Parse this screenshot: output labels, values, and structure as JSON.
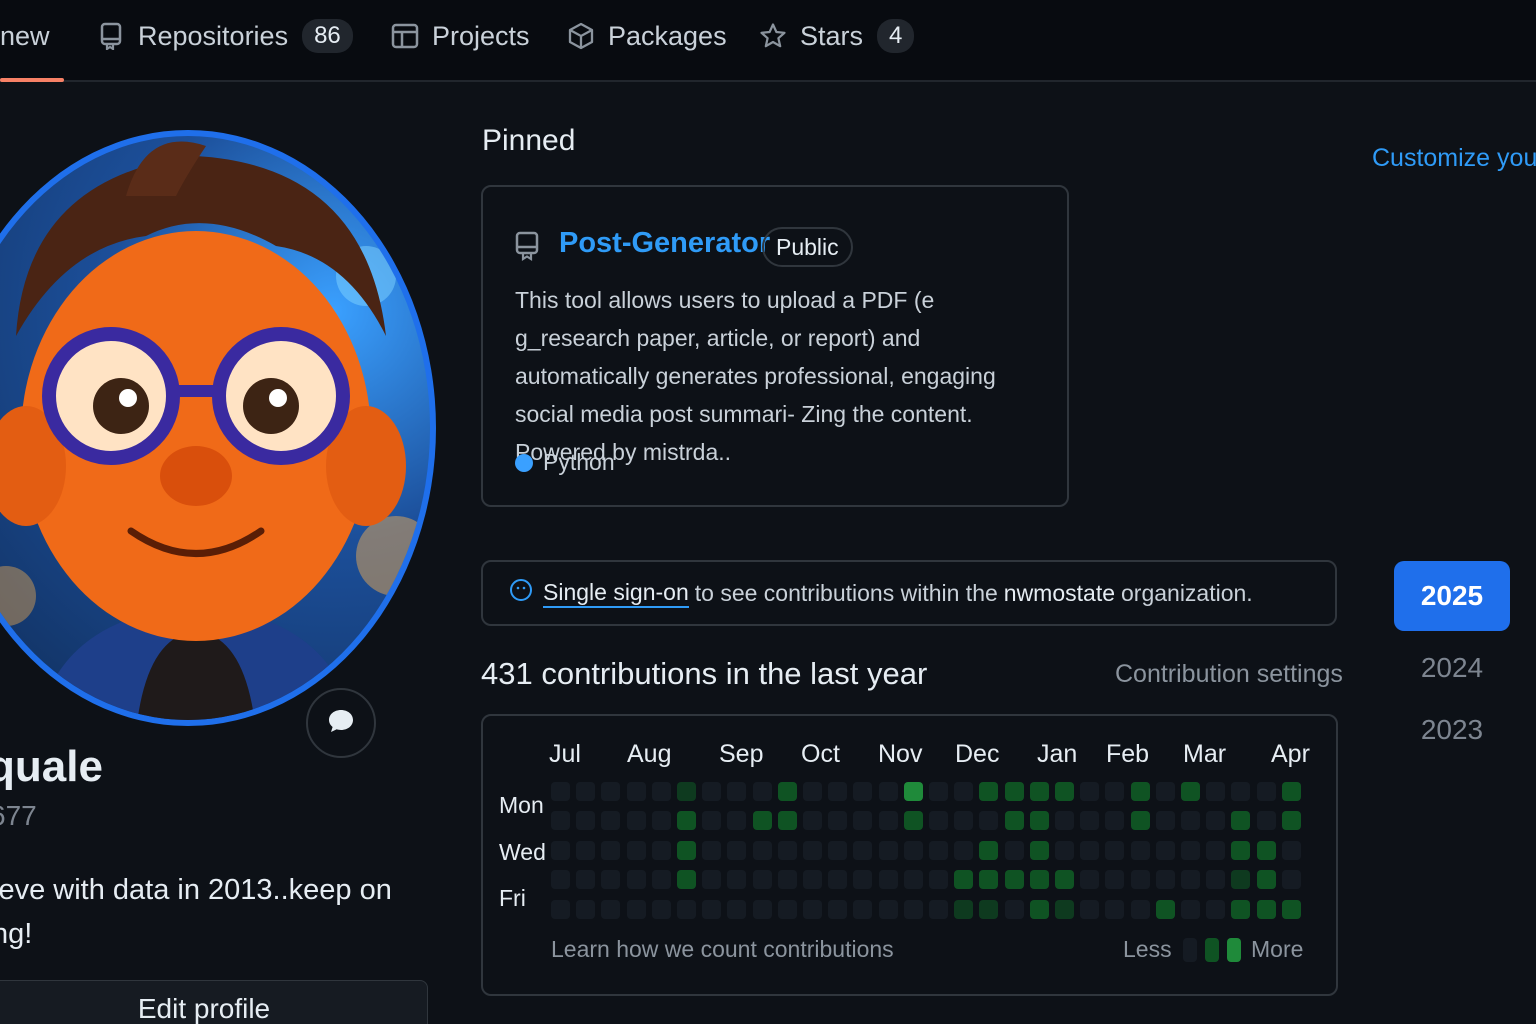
{
  "nav": {
    "overview_label": "new",
    "tabs": [
      {
        "label": "Repositories",
        "count": "86"
      },
      {
        "label": "Projects",
        "count": ""
      },
      {
        "label": "Packages",
        "count": ""
      },
      {
        "label": "Stars",
        "count": "4"
      }
    ]
  },
  "profile": {
    "name": "quale",
    "handle": "677",
    "bio": "leve with data  in 2013..keep on ng!",
    "edit_label": "Edit profile"
  },
  "pinned": {
    "title": "Pinned",
    "customize_label": "Customize your",
    "repo": {
      "name": "Post-Generator",
      "visibility": "Public",
      "description": "This tool allows users to upload a PDF (e g_research paper, article, or report) and automatically generates professional, engaging social media post summari- Zing the content. Powered by mistrda..",
      "language": "Python",
      "language_color": "#3aa0ff"
    }
  },
  "sso": {
    "link": "Single sign-on",
    "text_before_org": "to see contributions within the",
    "org": "nwmostate",
    "text_after_org": "organization."
  },
  "contributions": {
    "title": "431 contributions in the last year",
    "settings_label": "Contribution settings",
    "months": [
      "Jul",
      "Aug",
      "Sep",
      "Oct",
      "Nov",
      "Dec",
      "Jan",
      "Feb",
      "Mar",
      "Apr"
    ],
    "days": [
      "Mon",
      "Wed",
      "Fri"
    ],
    "learn_label": "Learn how we count contributions",
    "legend_less": "Less",
    "legend_more": "More",
    "levels": [
      [
        0,
        0,
        0,
        0,
        0,
        1,
        0,
        0,
        0,
        2,
        0,
        0,
        0,
        0,
        3,
        0,
        0,
        2,
        2,
        2,
        2,
        0,
        0,
        2,
        0,
        2,
        0,
        0,
        0,
        2
      ],
      [
        0,
        0,
        0,
        0,
        0,
        2,
        0,
        0,
        2,
        2,
        0,
        0,
        0,
        0,
        2,
        0,
        0,
        0,
        2,
        2,
        0,
        0,
        0,
        2,
        0,
        0,
        0,
        2,
        0,
        2
      ],
      [
        0,
        0,
        0,
        0,
        0,
        2,
        0,
        0,
        0,
        0,
        0,
        0,
        0,
        0,
        0,
        0,
        0,
        2,
        0,
        2,
        0,
        0,
        0,
        0,
        0,
        0,
        0,
        2,
        2,
        0
      ],
      [
        0,
        0,
        0,
        0,
        0,
        2,
        0,
        0,
        0,
        0,
        0,
        0,
        0,
        0,
        0,
        0,
        2,
        2,
        2,
        2,
        2,
        0,
        0,
        0,
        0,
        0,
        0,
        1,
        2,
        0
      ],
      [
        0,
        0,
        0,
        0,
        0,
        0,
        0,
        0,
        0,
        0,
        0,
        0,
        0,
        0,
        0,
        0,
        1,
        1,
        0,
        2,
        1,
        0,
        0,
        0,
        2,
        0,
        0,
        2,
        2,
        2
      ]
    ]
  },
  "years": [
    "2025",
    "2024",
    "2023"
  ],
  "colors": {
    "accent": "#1f6feb",
    "link": "#2f9bf7",
    "tab_underline": "#f78166",
    "level0": "#151b23",
    "level1": "#0e3a1f",
    "level2": "#0f5323",
    "level3": "#1f8a3a"
  }
}
